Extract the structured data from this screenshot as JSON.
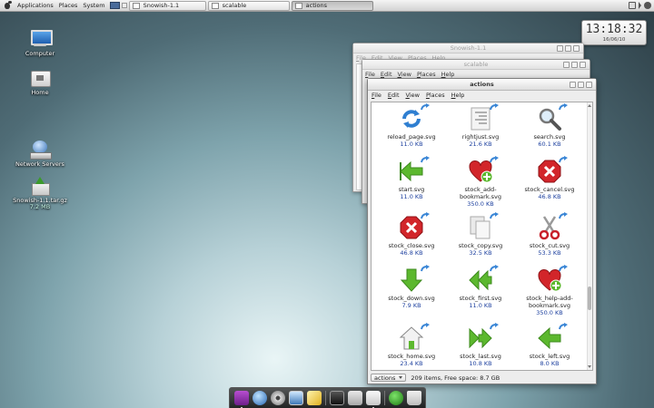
{
  "top_panel": {
    "menus": [
      "Applications",
      "Places",
      "System"
    ],
    "tasks": [
      {
        "label": "Snowish-1.1",
        "active": false
      },
      {
        "label": "scalable",
        "active": false
      },
      {
        "label": "actions",
        "active": true
      }
    ]
  },
  "clock": {
    "time": "13:18:32",
    "date": "16/06/10"
  },
  "desktop_icons": [
    {
      "label": "Computer",
      "icon": "computer-icon"
    },
    {
      "label": "Home",
      "icon": "home-folder-icon"
    },
    {
      "label": "Network Servers",
      "icon": "network-servers-icon"
    },
    {
      "label": "Snowish-1.1.tar.gz",
      "sub": "7.2 MB",
      "icon": "archive-icon"
    }
  ],
  "back_windows": [
    {
      "title": "Snowish-1.1",
      "menus": [
        "File",
        "Edit",
        "View",
        "Places",
        "Help"
      ]
    },
    {
      "title": "scalable",
      "menus": [
        "File",
        "Edit",
        "View",
        "Places",
        "Help"
      ]
    }
  ],
  "window": {
    "title": "actions",
    "menus": [
      "File",
      "Edit",
      "View",
      "Places",
      "Help"
    ],
    "files": [
      {
        "name": "reload_page.svg",
        "size": "11.0 KB",
        "icon": "reload-icon"
      },
      {
        "name": "rightjust.svg",
        "size": "21.6 KB",
        "icon": "justify-right-icon"
      },
      {
        "name": "search.svg",
        "size": "60.1 KB",
        "icon": "search-icon"
      },
      {
        "name": "start.svg",
        "size": "11.0 KB",
        "icon": "start-arrow-icon"
      },
      {
        "name": "stock_add-bookmark.svg",
        "size": "350.0 KB",
        "icon": "add-bookmark-icon"
      },
      {
        "name": "stock_cancel.svg",
        "size": "46.8 KB",
        "icon": "cancel-icon"
      },
      {
        "name": "stock_close.svg",
        "size": "46.8 KB",
        "icon": "close-icon"
      },
      {
        "name": "stock_copy.svg",
        "size": "32.5 KB",
        "icon": "copy-icon"
      },
      {
        "name": "stock_cut.svg",
        "size": "53.3 KB",
        "icon": "scissors-icon"
      },
      {
        "name": "stock_down.svg",
        "size": "7.9 KB",
        "icon": "down-arrow-icon"
      },
      {
        "name": "stock_first.svg",
        "size": "11.0 KB",
        "icon": "first-arrow-icon"
      },
      {
        "name": "stock_help-add-bookmark.svg",
        "size": "350.0 KB",
        "icon": "help-add-bookmark-icon"
      },
      {
        "name": "stock_home.svg",
        "size": "23.4 KB",
        "icon": "home-icon"
      },
      {
        "name": "stock_last.svg",
        "size": "10.8 KB",
        "icon": "last-arrow-icon"
      },
      {
        "name": "stock_left.svg",
        "size": "8.0 KB",
        "icon": "left-arrow-icon"
      }
    ],
    "status": {
      "location": "actions",
      "summary": "209 items, Free space: 8.7 GB"
    }
  },
  "colors": {
    "file_size": "#1c3f9e",
    "arrow_green": "#5cb82e",
    "stop_red": "#d2252a"
  }
}
